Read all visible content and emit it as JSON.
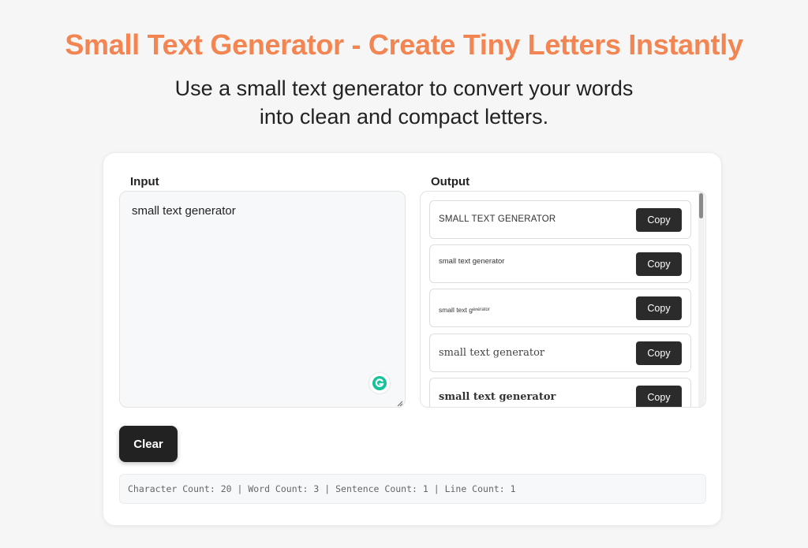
{
  "header": {
    "title": "Small Text Generator - Create Tiny Letters Instantly",
    "subtitle_line1": "Use a small text generator to convert your words",
    "subtitle_line2": "into clean and compact letters."
  },
  "input": {
    "label": "Input",
    "value": "small text generator"
  },
  "output": {
    "label": "Output",
    "rows": [
      {
        "text": "SMALL TEXT GENERATOR",
        "copy_label": "Copy"
      },
      {
        "text": "small text generator",
        "copy_label": "Copy"
      },
      {
        "text": "small text ɡᵉⁿᵉʳᵃᵗᵒʳ",
        "copy_label": "Copy"
      },
      {
        "text": "small text generator",
        "copy_label": "Copy"
      },
      {
        "text": "small text generator",
        "copy_label": "Copy"
      }
    ]
  },
  "actions": {
    "clear_label": "Clear"
  },
  "stats": {
    "text": "Character Count: 20 | Word Count: 3 | Sentence Count: 1 | Line Count: 1"
  },
  "colors": {
    "title": "#f28552",
    "button_bg": "#2b2b2b",
    "grammarly": "#15c39a"
  },
  "icons": {
    "grammarly_badge": "grammarly-icon",
    "resize_handle": "resize-handle-icon"
  }
}
